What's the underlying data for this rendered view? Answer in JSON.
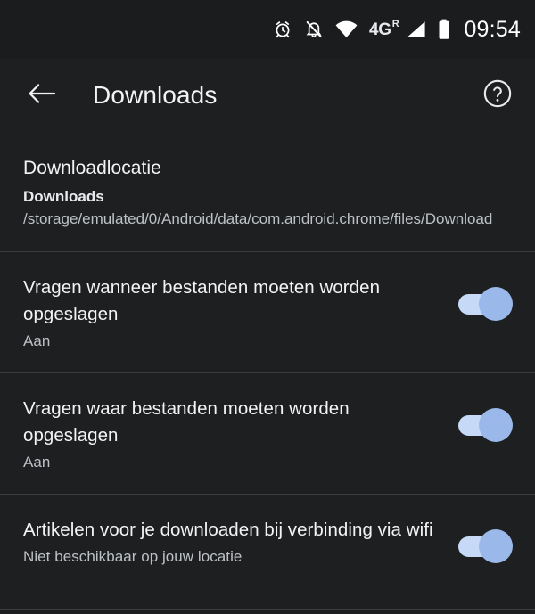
{
  "status_bar": {
    "icons": [
      "alarm-icon",
      "bell-off-icon",
      "wifi-icon",
      "signal-icon",
      "battery-icon"
    ],
    "network_type": "4G",
    "roaming_indicator": "R",
    "time": "09:54"
  },
  "app_bar": {
    "back_icon": "arrow-left-icon",
    "title": "Downloads",
    "help_icon": "help-circle-icon"
  },
  "settings": {
    "download_location": {
      "title": "Downloadlocatie",
      "value_label": "Downloads",
      "value_path": "/storage/emulated/0/Android/data/com.android.chrome/files/Download"
    },
    "rows": [
      {
        "title": "Vragen wanneer bestanden moeten worden opgeslagen",
        "subtitle": "Aan",
        "toggle": "on"
      },
      {
        "title": "Vragen waar bestanden moeten worden opgeslagen",
        "subtitle": "Aan",
        "toggle": "on"
      },
      {
        "title": "Artikelen voor je downloaden bij verbinding via wifi",
        "subtitle": "Niet beschikbaar op jouw locatie",
        "toggle": "on"
      }
    ]
  },
  "colors": {
    "background": "#1e1f20",
    "status_bar_bg": "#1b1c1d",
    "primary_text": "#f1f3f4",
    "secondary_text": "#bdc1c6",
    "divider": "#3a3b3c",
    "toggle_track": "#c6d9f7",
    "toggle_thumb": "#9ab9ea"
  }
}
